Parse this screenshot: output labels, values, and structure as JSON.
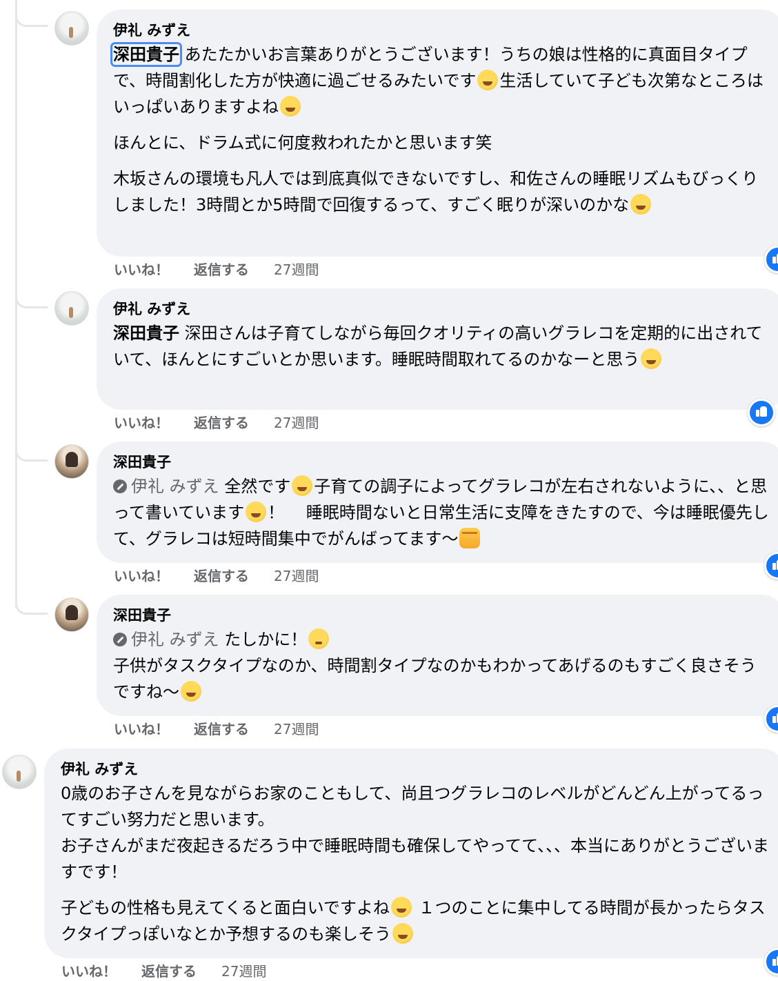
{
  "comments": [
    {
      "author": "伊礼 みずえ",
      "mention": "深田貴子",
      "paragraphs": [
        "あたたかいお言葉ありがとうございます！うちの娘は性格的に真面目タイプで、時間割化した方が快適に過ごせるみたいです",
        "生活していて子ども次第なところはいっぱいありますよね",
        "ほんとに、ドラム式に何度救われたかと思います笑",
        "木坂さんの環境も凡人では到底真似できないですし、和佐さんの睡眠リズムもびっくりしました！3時間とか5時間で回復するって、すごく眠りが深いのかな"
      ],
      "like": "いいね！",
      "reply": "返信する",
      "time": "27週間"
    },
    {
      "author": "伊礼 みずえ",
      "mention": "深田貴子",
      "text": "深田さんは子育てしながら毎回クオリティの高いグラレコを定期的に出されていて、ほんとにすごいとか思います。睡眠時間取れてるのかなーと思う",
      "like": "いいね！",
      "reply": "返信する",
      "time": "27週間"
    },
    {
      "author": "深田貴子",
      "mention": "伊礼 みずえ",
      "text_a": "全然です",
      "text_b": "子育ての調子によってグラレコが左右されないように、、と思って書いています",
      "text_c": "！　 睡眠時間ないと日常生活に支障をきたすので、今は睡眠優先して、グラレコは短時間集中でがんばってます〜",
      "like": "いいね！",
      "reply": "返信する",
      "time": "27週間"
    },
    {
      "author": "深田貴子",
      "mention": "伊礼 みずえ",
      "text_a": "たしかに！",
      "text_b": "子供がタスクタイプなのか、時間割タイプなのかもわかってあげるのもすごく良さそうですね〜",
      "like": "いいね！",
      "reply": "返信する",
      "time": "27週間"
    },
    {
      "author": "伊礼 みずえ",
      "p1": "0歳のお子さんを見ながらお家のこともして、尚且つグラレコのレベルがどんどん上がってるってすごい努力だと思います。\nお子さんがまだ夜起きるだろう中で睡眠時間も確保してやってて、、、本当にありがとうございますです！",
      "p2a": "子どもの性格も見えてくると面白いですよね",
      "p2b": " １つのことに集中してる時間が長かったらタスクタイプっぽいなとか予想するのも楽しそう",
      "like": "いいね！",
      "reply": "返信する",
      "time": "27週間"
    }
  ],
  "icons": [
    "like-reaction-icon",
    "grinning-emoji",
    "tears-of-joy-emoji",
    "sweat-smile-emoji",
    "fist-emoji",
    "flushed-emoji",
    "smiling-hearts-emoji",
    "edit-pen-icon"
  ]
}
